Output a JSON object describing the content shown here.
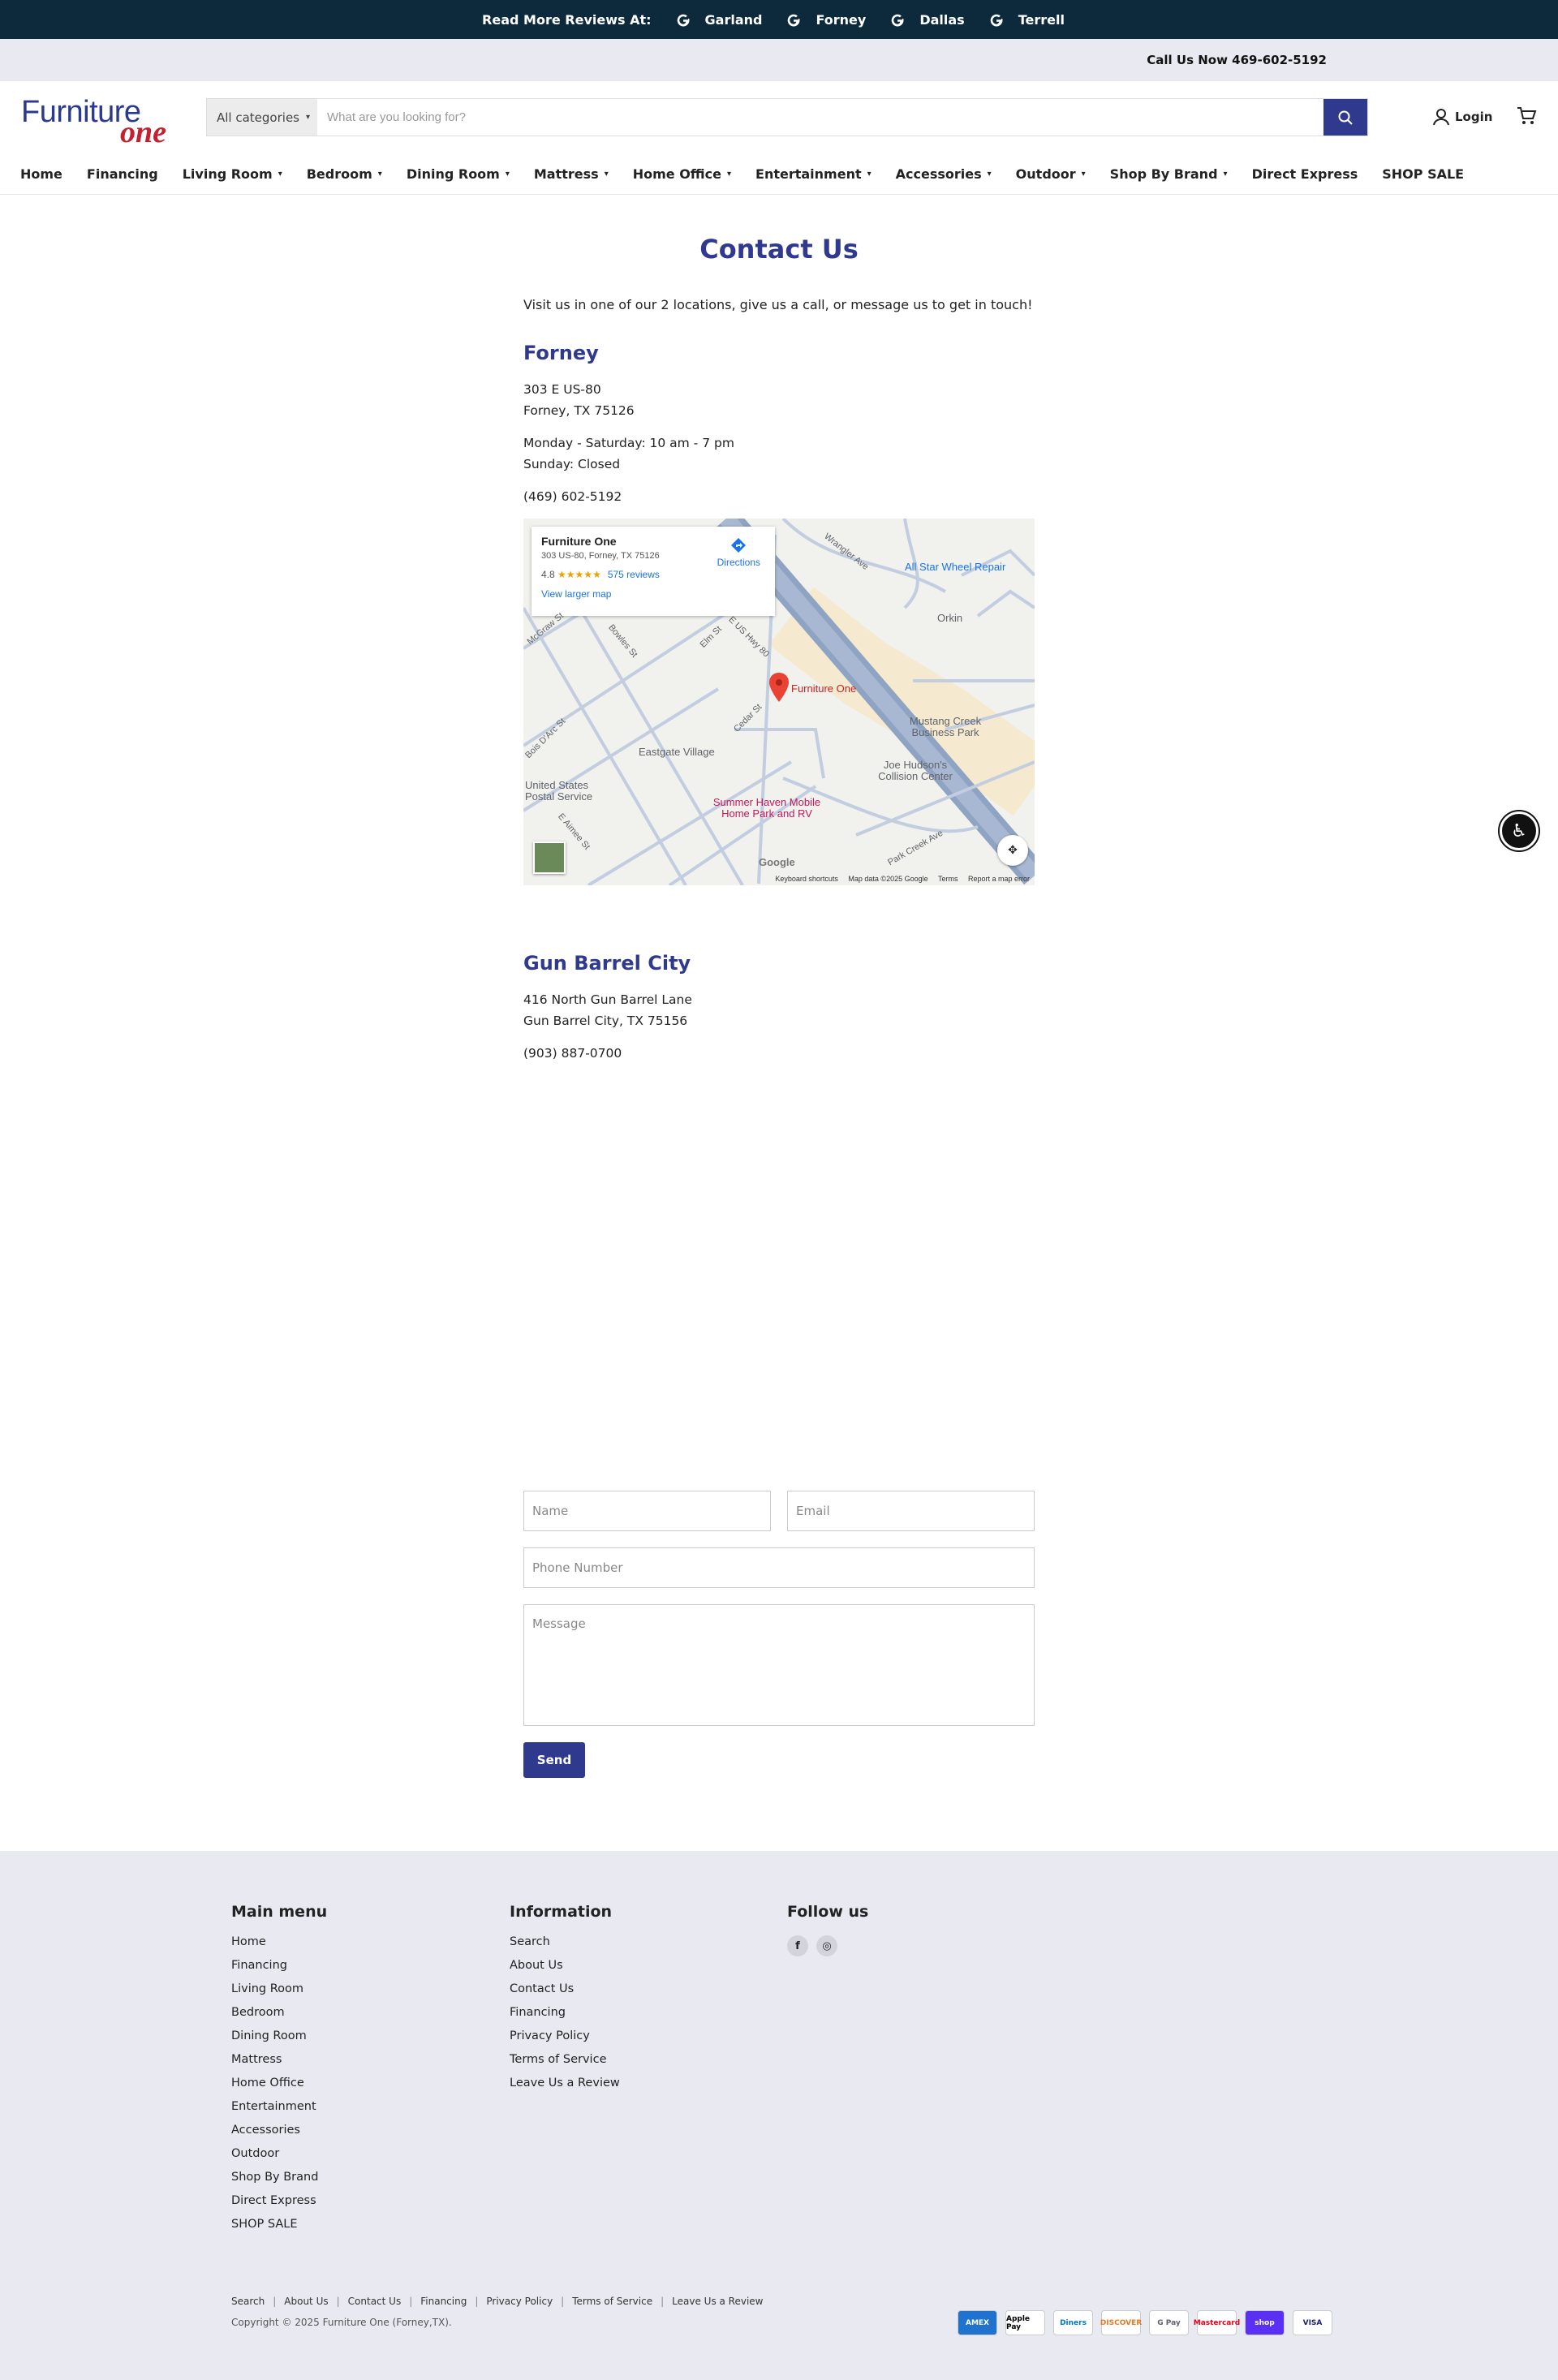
{
  "topbar": {
    "label": "Read More Reviews At:",
    "locations": [
      "Garland",
      "Forney",
      "Dallas",
      "Terrell"
    ]
  },
  "callbar": {
    "text": "Call Us Now 469-602-5192"
  },
  "header": {
    "logo_top": "Furniture",
    "logo_bottom": "one",
    "category": "All categories",
    "search_placeholder": "What are you looking for?",
    "login": "Login"
  },
  "nav": [
    {
      "label": "Home",
      "dropdown": false
    },
    {
      "label": "Financing",
      "dropdown": false
    },
    {
      "label": "Living Room",
      "dropdown": true
    },
    {
      "label": "Bedroom",
      "dropdown": true
    },
    {
      "label": "Dining Room",
      "dropdown": true
    },
    {
      "label": "Mattress",
      "dropdown": true
    },
    {
      "label": "Home Office",
      "dropdown": true
    },
    {
      "label": "Entertainment",
      "dropdown": true
    },
    {
      "label": "Accessories",
      "dropdown": true
    },
    {
      "label": "Outdoor",
      "dropdown": true
    },
    {
      "label": "Shop By Brand",
      "dropdown": true
    },
    {
      "label": "Direct Express",
      "dropdown": false
    },
    {
      "label": "SHOP SALE",
      "dropdown": false
    }
  ],
  "page": {
    "title": "Contact Us",
    "intro": "Visit us in one of our 2 locations, give us a call, or message us to get in touch!"
  },
  "locations": [
    {
      "name": "Forney",
      "address1": "303 E US-80",
      "address2": "Forney, TX 75126",
      "hours1": "Monday - Saturday: 10 am - 7 pm",
      "hours2": "Sunday: Closed",
      "phone": "(469) 602-5192"
    },
    {
      "name": "Gun Barrel City",
      "address1": "416 North Gun Barrel Lane",
      "address2": "Gun Barrel City, TX 75156",
      "phone": "(903) 887-0700"
    }
  ],
  "map": {
    "place": "Furniture One",
    "address": "303 US-80, Forney, TX 75126",
    "rating": "4.8",
    "stars": "★★★★★",
    "reviews": "575 reviews",
    "directions": "Directions",
    "larger": "View larger map",
    "labels": {
      "pin": "Furniture One",
      "allstar": "All Star Wheel Repair",
      "orkin": "Orkin",
      "mustang": "Mustang Creek Business Park",
      "joe": "Joe Hudson's Collision Center",
      "eastgate": "Eastgate Village",
      "postal": "United States Postal Service",
      "summer": "Summer Haven Mobile Home Park and RV",
      "wrangler": "Wrangler Ave",
      "hwy": "E US Hwy 80",
      "cedar": "Cedar St",
      "elm": "Elm St",
      "bois": "Bois D'Arc St",
      "mcgraw": "McGraw St",
      "bowles": "Bowles St",
      "aimee": "E Aimee St",
      "park": "Park Creek Ave",
      "google": "Google"
    },
    "footer": [
      "Keyboard shortcuts",
      "Map data ©2025 Google",
      "Terms",
      "Report a map error"
    ]
  },
  "form": {
    "name": "Name",
    "email": "Email",
    "phone": "Phone Number",
    "message": "Message",
    "send": "Send"
  },
  "footer": {
    "main_title": "Main menu",
    "main_items": [
      "Home",
      "Financing",
      "Living Room",
      "Bedroom",
      "Dining Room",
      "Mattress",
      "Home Office",
      "Entertainment",
      "Accessories",
      "Outdoor",
      "Shop By Brand",
      "Direct Express",
      "SHOP SALE"
    ],
    "info_title": "Information",
    "info_items": [
      "Search",
      "About Us",
      "Contact Us",
      "Financing",
      "Privacy Policy",
      "Terms of Service",
      "Leave Us a Review"
    ],
    "follow_title": "Follow us",
    "bottom_links": [
      "Search",
      "About Us",
      "Contact Us",
      "Financing",
      "Privacy Policy",
      "Terms of Service",
      "Leave Us a Review"
    ],
    "copyright": "Copyright © 2025 Furniture One (Forney,TX).",
    "payments": [
      "AMEX",
      "Apple Pay",
      "Diners",
      "DISCOVER",
      "G Pay",
      "Mastercard",
      "shop",
      "VISA"
    ]
  }
}
